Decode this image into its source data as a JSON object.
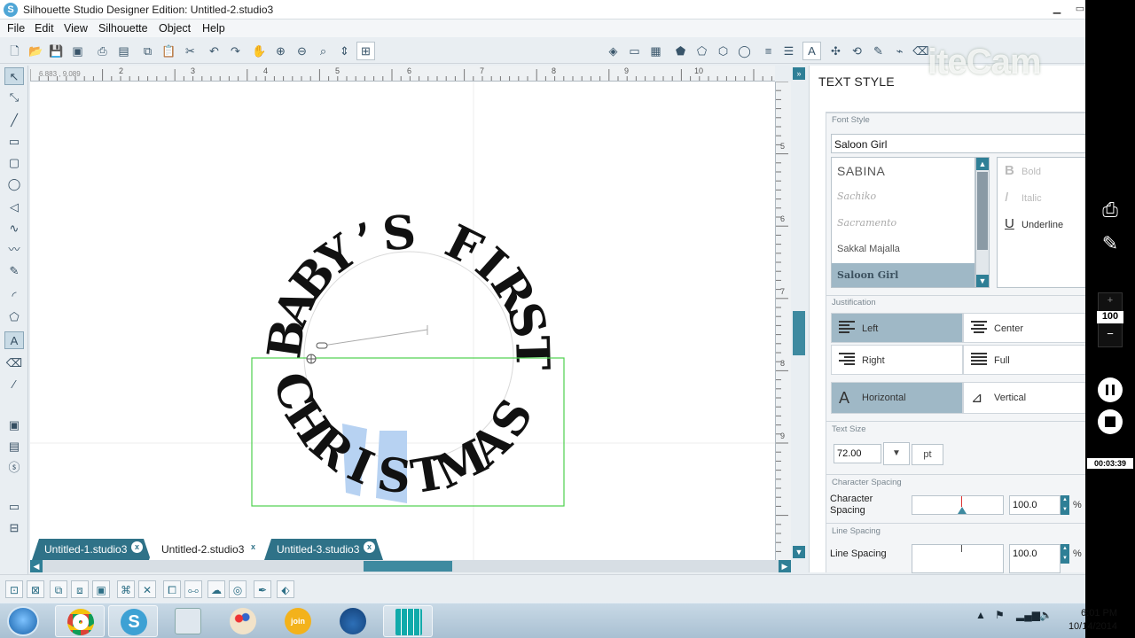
{
  "window": {
    "title": "Silhouette Studio Designer Edition: Untitled-2.studio3"
  },
  "menu": [
    "File",
    "Edit",
    "View",
    "Silhouette",
    "Object",
    "Help"
  ],
  "ruler": {
    "coord": "6.883 , 9.089",
    "h_ticks": [
      "2",
      "3",
      "4",
      "5",
      "6",
      "7",
      "8",
      "9",
      "10"
    ],
    "v_ticks": [
      "5",
      "6",
      "7",
      "8",
      "9"
    ]
  },
  "canvas": {
    "arc_top": [
      "B",
      "A",
      "B",
      "Y",
      "’",
      "S",
      " ",
      "F",
      "I",
      "R",
      "S",
      "T"
    ],
    "arc_bottom": [
      "C",
      "H",
      "R",
      "I",
      "S",
      "T",
      "M",
      "A",
      "S"
    ]
  },
  "tabs": [
    {
      "label": "Untitled-1.studio3",
      "active": false
    },
    {
      "label": "Untitled-2.studio3",
      "active": true
    },
    {
      "label": "Untitled-3.studio3",
      "active": false
    }
  ],
  "panel": {
    "title": "TEXT STYLE",
    "font_style_label": "Font Style",
    "font_value": "Saloon Girl",
    "font_list": [
      {
        "label": "SABINA",
        "selected": false
      },
      {
        "label": "Sachiko",
        "selected": false
      },
      {
        "label": "Sacramento",
        "selected": false
      },
      {
        "label": "Sakkal Majalla",
        "selected": false
      },
      {
        "label": "Saloon Girl",
        "selected": true
      }
    ],
    "styles": [
      {
        "label": "Bold",
        "icon": "B",
        "enabled": false
      },
      {
        "label": "Italic",
        "icon": "I",
        "enabled": false
      },
      {
        "label": "Underline",
        "icon": "U",
        "enabled": true
      }
    ],
    "justification_label": "Justification",
    "justify": [
      "Left",
      "Center",
      "Right",
      "Full"
    ],
    "orientation": [
      "Horizontal",
      "Vertical"
    ],
    "text_size_label": "Text Size",
    "text_size_value": "72.00",
    "text_size_unit": "pt",
    "char_spacing_header": "Character Spacing",
    "char_spacing_label": "Character Spacing",
    "char_spacing_value": "100.0",
    "line_spacing_header": "Line Spacing",
    "line_spacing_label": "Line Spacing",
    "line_spacing_value": "100.0",
    "percent": "%"
  },
  "recorder": {
    "zoom": "100",
    "timer": "00:03:39",
    "plus": "+",
    "minus": "−"
  },
  "watermark": "iteCam",
  "taskbar": {
    "time": "6:01 PM",
    "date": "10/14/2014"
  },
  "colors": {
    "accent": "#2f7288",
    "selection": "#9fb8c6",
    "bbox": "#4dd04d"
  }
}
